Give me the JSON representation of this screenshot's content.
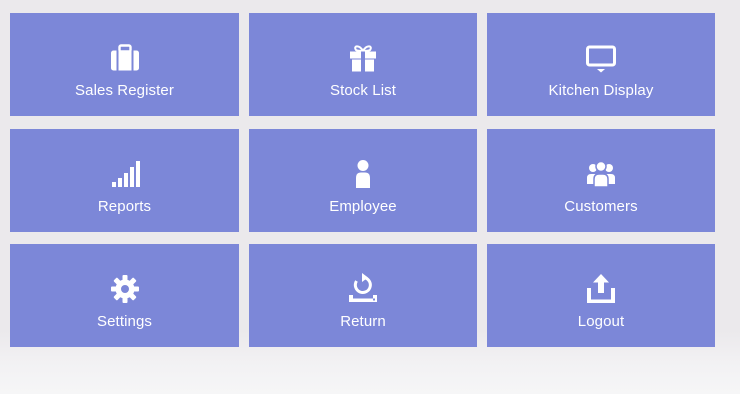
{
  "menu": {
    "sales_register": {
      "label": "Sales Register",
      "icon": "briefcase-icon"
    },
    "stock_list": {
      "label": "Stock List",
      "icon": "gift-icon"
    },
    "kitchen_display": {
      "label": "Kitchen Display",
      "icon": "monitor-icon"
    },
    "reports": {
      "label": "Reports",
      "icon": "signal-bars-icon"
    },
    "employee": {
      "label": "Employee",
      "icon": "user-icon"
    },
    "customers": {
      "label": "Customers",
      "icon": "users-group-icon"
    },
    "settings": {
      "label": "Settings",
      "icon": "gear-icon"
    },
    "return": {
      "label": "Return",
      "icon": "return-icon"
    },
    "logout": {
      "label": "Logout",
      "icon": "upload-logout-icon"
    }
  },
  "colors": {
    "tile_background": "#7c87d8",
    "page_background": "#ebe9ec",
    "text": "#ffffff"
  }
}
